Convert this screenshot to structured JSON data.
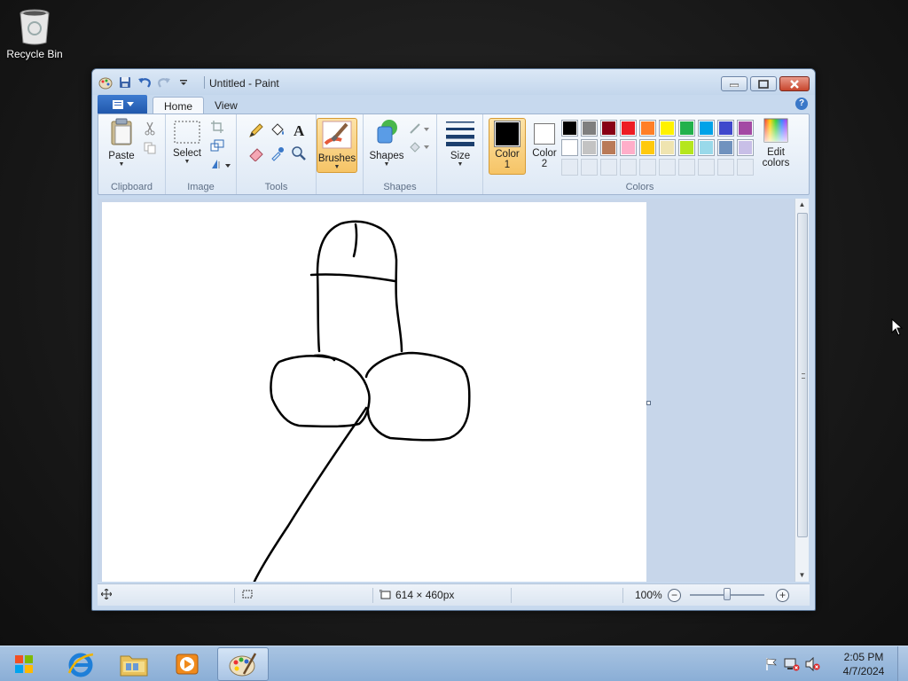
{
  "desktop": {
    "icons": [
      {
        "label": "Recycle Bin",
        "icon": "recycle-bin-icon"
      }
    ]
  },
  "window": {
    "title": "Untitled - Paint",
    "tabs": [
      {
        "label": "Home",
        "active": true
      },
      {
        "label": "View",
        "active": false
      }
    ],
    "ribbon": {
      "clipboard": {
        "group_label": "Clipboard",
        "paste_label": "Paste"
      },
      "image": {
        "group_label": "Image",
        "select_label": "Select"
      },
      "tools": {
        "group_label": "Tools"
      },
      "brushes": {
        "label": "Brushes"
      },
      "shapes": {
        "group_label": "Shapes",
        "label": "Shapes"
      },
      "size": {
        "label": "Size"
      },
      "colors": {
        "group_label": "Colors",
        "color1_label": "Color",
        "color1_num": "1",
        "color1_value": "#000000",
        "color2_label": "Color",
        "color2_num": "2",
        "color2_value": "#ffffff",
        "edit_label_1": "Edit",
        "edit_label_2": "colors",
        "palette": [
          "#000000",
          "#7f7f7f",
          "#880015",
          "#ed1c24",
          "#ff7f27",
          "#fff200",
          "#22b14c",
          "#00a2e8",
          "#3f48cc",
          "#a349a4",
          "#ffffff",
          "#c3c3c3",
          "#b97a57",
          "#ffaec9",
          "#ffc90e",
          "#efe4b0",
          "#b5e61d",
          "#99d9ea",
          "#7092be",
          "#c8bfe7",
          "",
          "",
          "",
          "",
          "",
          "",
          "",
          "",
          "",
          ""
        ]
      }
    },
    "statusbar": {
      "canvas_size": "614 × 460px",
      "zoom": "100%",
      "zoom_level": 1.0
    }
  },
  "taskbar": {
    "apps": [
      {
        "name": "internet-explorer-icon",
        "active": false
      },
      {
        "name": "file-explorer-icon",
        "active": false
      },
      {
        "name": "media-player-icon",
        "active": false
      },
      {
        "name": "paint-icon",
        "active": true
      }
    ],
    "clock_time": "2:05 PM",
    "clock_date": "4/7/2024"
  }
}
